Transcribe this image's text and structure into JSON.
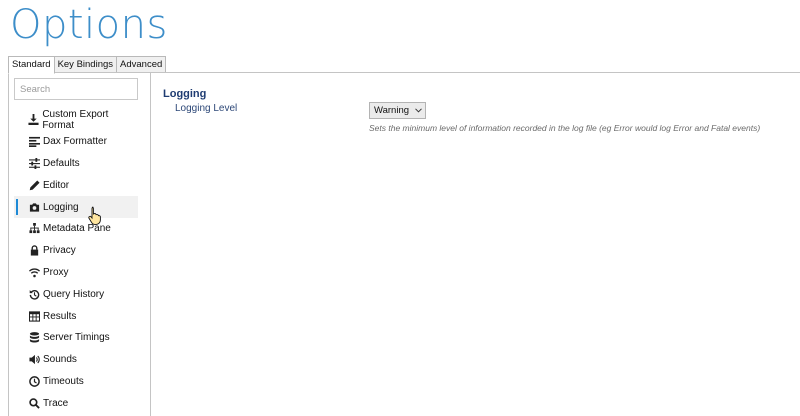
{
  "window": {
    "title": "Options"
  },
  "tabs": [
    {
      "label": "Standard",
      "active": true
    },
    {
      "label": "Key Bindings",
      "active": false
    },
    {
      "label": "Advanced",
      "active": false
    }
  ],
  "search": {
    "placeholder": "Search",
    "value": ""
  },
  "sidebar": {
    "items": [
      {
        "label": "Custom Export Format",
        "icon": "download-icon"
      },
      {
        "label": "Dax Formatter",
        "icon": "align-left-icon"
      },
      {
        "label": "Defaults",
        "icon": "sliders-icon"
      },
      {
        "label": "Editor",
        "icon": "pencil-icon"
      },
      {
        "label": "Logging",
        "icon": "camera-icon",
        "selected": true
      },
      {
        "label": "Metadata Pane",
        "icon": "sitemap-icon"
      },
      {
        "label": "Privacy",
        "icon": "lock-icon"
      },
      {
        "label": "Proxy",
        "icon": "wifi-icon"
      },
      {
        "label": "Query History",
        "icon": "history-icon"
      },
      {
        "label": "Results",
        "icon": "table-icon"
      },
      {
        "label": "Server Timings",
        "icon": "database-icon"
      },
      {
        "label": "Sounds",
        "icon": "volume-icon"
      },
      {
        "label": "Timeouts",
        "icon": "clock-icon"
      },
      {
        "label": "Trace",
        "icon": "search-icon"
      }
    ]
  },
  "main": {
    "section_title": "Logging",
    "setting": {
      "label": "Logging Level",
      "value": "Warning",
      "description": "Sets the minimum level of information recorded in the log file (eg Error would log Error and Fatal events)"
    }
  },
  "colors": {
    "title": "#3d8ec9",
    "accent": "#1e8ad6",
    "section_title": "#1f3c72"
  }
}
